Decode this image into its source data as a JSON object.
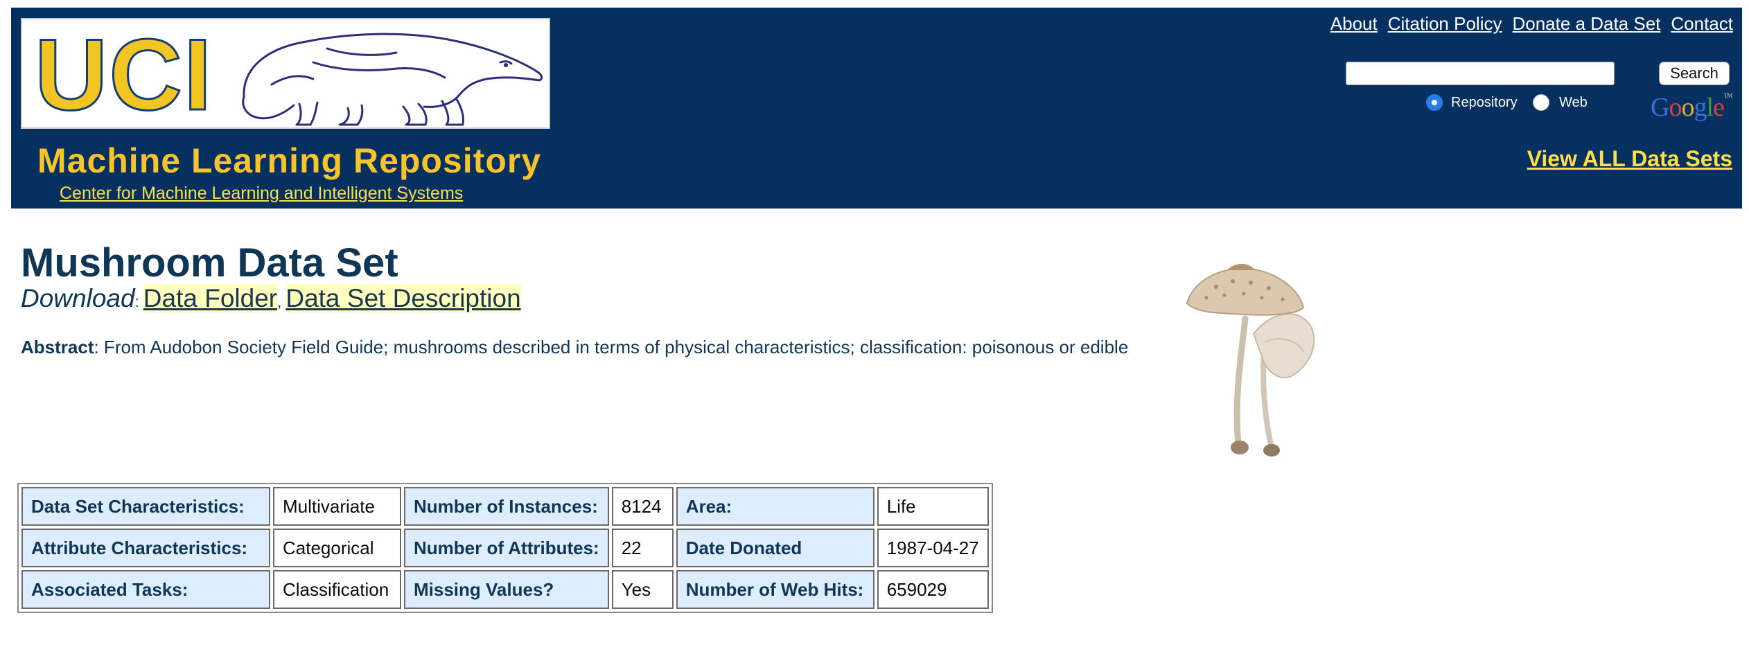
{
  "header": {
    "logo_text": "UCI",
    "title": "Machine Learning Repository",
    "subtitle_link": "Center for Machine Learning and Intelligent Systems",
    "nav_links": [
      "About",
      "Citation Policy",
      "Donate a Data Set",
      "Contact"
    ],
    "search": {
      "value": "",
      "button_label": "Search",
      "options": [
        {
          "label": "Repository",
          "checked": true
        },
        {
          "label": "Web",
          "checked": false
        }
      ],
      "provider_logo": "Google",
      "provider_tm": "TM"
    },
    "view_all": "View ALL Data Sets"
  },
  "dataset": {
    "title": "Mushroom Data Set",
    "download_label": "Download",
    "download_links": [
      "Data Folder",
      "Data Set Description"
    ],
    "abstract_label": "Abstract",
    "abstract": ": From Audobon Society Field Guide; mushrooms described in terms of physical characteristics; classification: poisonous or edible",
    "image_icon": "mushroom-photo"
  },
  "details_table": {
    "rows": [
      [
        {
          "label": "Data Set Characteristics:",
          "value": "Multivariate"
        },
        {
          "label": "Number of Instances:",
          "value": "8124"
        },
        {
          "label": "Area:",
          "value": "Life"
        }
      ],
      [
        {
          "label": "Attribute Characteristics:",
          "value": "Categorical"
        },
        {
          "label": "Number of Attributes:",
          "value": "22"
        },
        {
          "label": "Date Donated",
          "value": "1987-04-27"
        }
      ],
      [
        {
          "label": "Associated Tasks:",
          "value": "Classification"
        },
        {
          "label": "Missing Values?",
          "value": "Yes"
        },
        {
          "label": "Number of Web Hits:",
          "value": "659029"
        }
      ]
    ]
  },
  "colors": {
    "header_bg": "#06305f",
    "brand_yellow": "#f7c52b",
    "link_yellow": "#fbe04a",
    "title_navy": "#0f3655",
    "label_cell_bg": "#deedfd",
    "link_highlight": "#ffffbe",
    "radio_accent": "#2a7de9"
  }
}
